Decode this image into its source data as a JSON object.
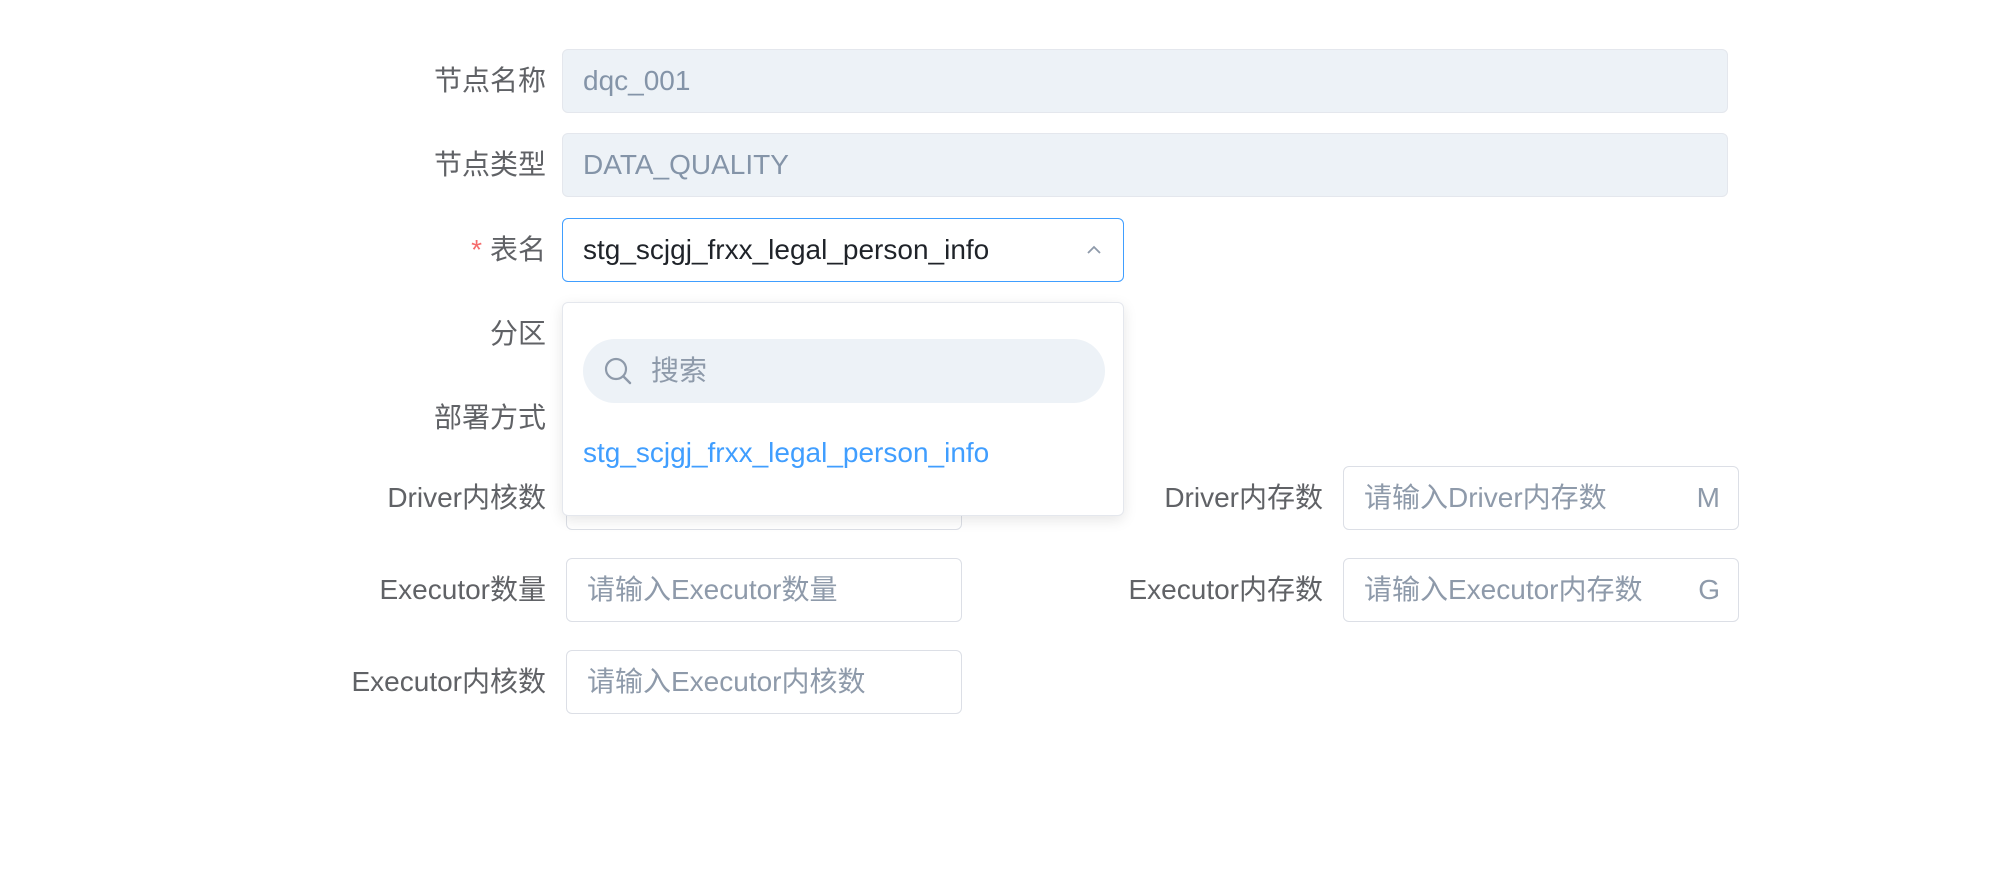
{
  "form": {
    "node_name": {
      "label": "节点名称",
      "value": "dqc_001"
    },
    "node_type": {
      "label": "节点类型",
      "value": "DATA_QUALITY"
    },
    "table_name": {
      "required_mark": "*",
      "label": "表名",
      "value": "stg_scjgj_frxx_legal_person_info"
    },
    "partition": {
      "label": "分区"
    },
    "deploy_mode": {
      "label": "部署方式"
    },
    "driver_cores": {
      "label": "Driver内核数"
    },
    "driver_memory": {
      "label": "Driver内存数",
      "placeholder": "请输入Driver内存数",
      "unit": "M"
    },
    "executor_count": {
      "label": "Executor数量",
      "placeholder": "请输入Executor数量"
    },
    "executor_memory": {
      "label": "Executor内存数",
      "placeholder": "请输入Executor内存数",
      "unit": "G"
    },
    "executor_cores": {
      "label": "Executor内核数",
      "placeholder": "请输入Executor内核数"
    }
  },
  "dropdown": {
    "search_placeholder": "搜索",
    "options": [
      "stg_scjgj_frxx_legal_person_info"
    ]
  },
  "colors": {
    "accent": "#409eff",
    "required": "#f56c6c",
    "disabled_bg": "#edf2f7"
  }
}
